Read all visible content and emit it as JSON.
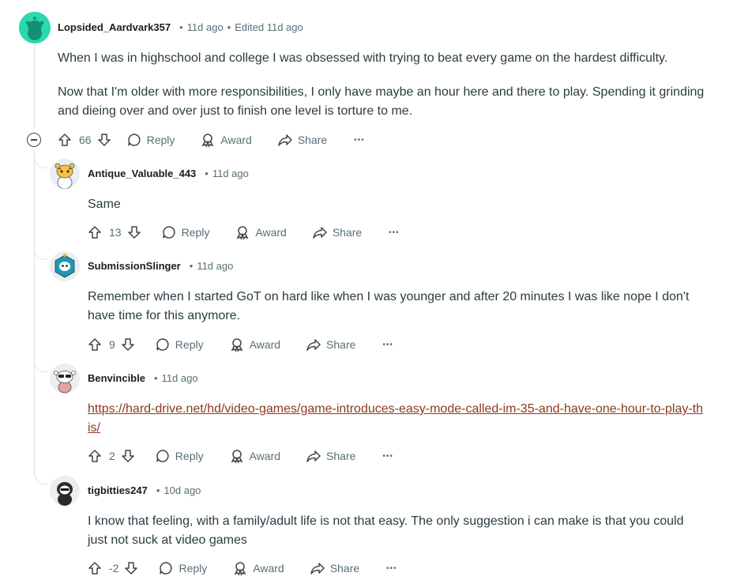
{
  "colors": {
    "link": "#8b3a1f",
    "meta": "#576f76",
    "thread_line": "#dfe3e6"
  },
  "action_labels": {
    "reply": "Reply",
    "award": "Award",
    "share": "Share",
    "more": "•••"
  },
  "comments": [
    {
      "author": "Lopsided_Aardvark357",
      "time": "11d ago",
      "edited": "Edited 11d ago",
      "paragraphs": [
        "When I was in highschool and college I was obsessed with trying to beat every game on the hardest difficulty.",
        "Now that I'm older with more responsibilities, I only have maybe an hour here and there to play. Spending it grinding and dieing over and over just to finish one level is torture to me."
      ],
      "score": "66"
    },
    {
      "author": "Antique_Valuable_443",
      "time": "11d ago",
      "text": "Same",
      "score": "13"
    },
    {
      "author": "SubmissionSlinger",
      "time": "11d ago",
      "text": "Remember when I started GoT on hard like when I was younger and after 20 minutes I was like nope I don't have time for this anymore.",
      "score": "9"
    },
    {
      "author": "Benvincible",
      "time": "11d ago",
      "link": "https://hard-drive.net/hd/video-games/game-introduces-easy-mode-called-im-35-and-have-one-hour-to-play-this/",
      "score": "2"
    },
    {
      "author": "tigbitties247",
      "time": "10d ago",
      "text": "I know that feeling, with a family/adult life is not that easy. The only suggestion i can make is that you could just not suck at video games",
      "score": "-2"
    }
  ]
}
